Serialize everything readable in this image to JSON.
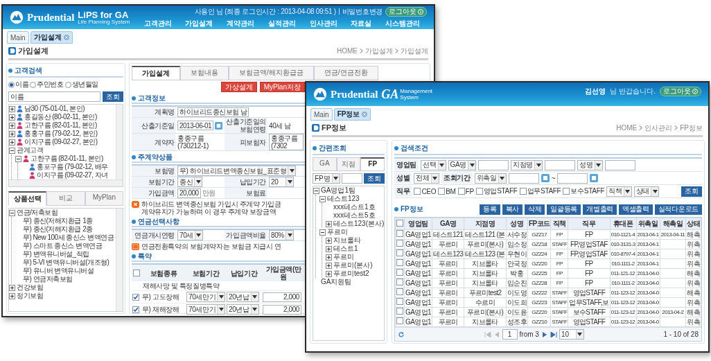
{
  "lips_window": {
    "brand": {
      "logo": "Prudential",
      "product": "LiPS for GA",
      "tagline": "Life Planning System"
    },
    "user_bar": {
      "greeting": "사용인 님 (최종 로그인시간 : 2013-04-08 09:51 )",
      "link": "비밀번호변경",
      "logout": "로그아웃"
    },
    "nav": [
      "고객관리",
      "가입설계",
      "계약관리",
      "실적관리",
      "인사관리",
      "자료실",
      "시스템관리"
    ],
    "open_tabs": [
      {
        "label": "Main",
        "selected": false,
        "closable": false
      },
      {
        "label": "가입설계",
        "selected": true,
        "closable": true
      }
    ],
    "page_title": "가입설계",
    "breadcrumb": [
      "HOME",
      "가입설계",
      "가입설계"
    ],
    "customer_search": {
      "title": "고객검색",
      "radios": [
        {
          "label": "이름",
          "selected": true
        },
        {
          "label": "주민번호",
          "selected": false
        },
        {
          "label": "생년월일",
          "selected": false
        }
      ],
      "query": "이름",
      "button": "조회",
      "tree": [
        {
          "label": "남30 (75-01-01, 본인)",
          "color": "#3a78c8",
          "expanded": false
        },
        {
          "label": "홍길동산 (80-02-11, 본인)",
          "color": "#3a78c8",
          "expanded": false
        },
        {
          "label": "고한구름 (82-01-11, 본인)",
          "color": "#c8396e",
          "expanded": false
        },
        {
          "label": "홍홍구름 (79-02-12, 본인)",
          "color": "#3a78c8",
          "expanded": false
        },
        {
          "label": "이지구름 (09-02-27, 본인)",
          "color": "#c8396e",
          "expanded": false
        },
        {
          "label": "관계고객",
          "expanded": true,
          "children": [
            {
              "label": "고한구름 (82-01-11, 본인)",
              "color": "#c8396e",
              "expanded": true,
              "children": [
                {
                  "label": "홍포구름 (79-02-12, 배우",
                  "color": "#3a78c8"
                },
                {
                  "label": "이지구름 (09-02-27, 자녀",
                  "color": "#c8396e"
                }
              ]
            }
          ]
        }
      ]
    },
    "product_tabs": [
      {
        "label": "상품선택",
        "selected": true
      },
      {
        "label": "비교",
        "selected": false
      },
      {
        "label": "MyPlan",
        "selected": false
      }
    ],
    "products": [
      {
        "label": "연금/저축보험",
        "expanded": true,
        "children": [
          {
            "label": "무) 종신(저해지환급 1종"
          },
          {
            "label": "무) 종신(저해지환급 2종"
          },
          {
            "label": "무) New 100세 종신스 변액연금"
          },
          {
            "label": "무) 스마트 종신스 변액연금"
          },
          {
            "label": "무) 변액유니버설_적립"
          },
          {
            "label": "무) 5-VI 변액유니버설(개조형)"
          },
          {
            "label": "무) 유니버 변액유니버설"
          },
          {
            "label": "무) 연금저축보험"
          }
        ]
      },
      {
        "label": "건강보험",
        "expanded": false
      },
      {
        "label": "정기보험",
        "expanded": false
      }
    ],
    "content_tabs": [
      {
        "label": "가입설계",
        "selected": true
      },
      {
        "label": "보험내용",
        "selected": false
      },
      {
        "label": "보험금액/해지환급금",
        "selected": false
      },
      {
        "label": "연금/연금전환",
        "selected": false
      }
    ],
    "action_buttons": [
      "가상설계",
      "MyPlan저장"
    ],
    "customer_info": {
      "title": "고객정보",
      "rows": [
        [
          {
            "label": "계획명",
            "kind": "input",
            "value": "하이브리드종신보험 남"
          }
        ],
        [
          {
            "label": "산출기준일",
            "kind": "date",
            "value": "2013-06-01"
          },
          {
            "label": "산출기준일의 보험연령",
            "kind": "text",
            "value": "40세 남"
          }
        ],
        [
          {
            "label": "계약자",
            "kind": "text",
            "value": "홍종구름(730212-1)"
          },
          {
            "label": "피보험자",
            "kind": "input",
            "value": "홍종구름(7302"
          }
        ]
      ]
    },
    "main_product": {
      "title": "주계약상품",
      "rows": [
        [
          {
            "label": "보험명",
            "kind": "select",
            "value": "무) 하이브리드변액종신보험_표준형"
          }
        ],
        [
          {
            "label": "보험기간",
            "kind": "select",
            "value": "종신"
          },
          {
            "label": "납입기간",
            "kind": "select",
            "value": "20"
          }
        ],
        [
          {
            "label": "가입금액",
            "kind": "input",
            "value": "20,000",
            "unit": "만원"
          },
          {
            "label": "보험료",
            "kind": "none"
          }
        ]
      ]
    },
    "notice": [
      "하이브리드 변액종신보험 가입시 주계약 가입금",
      "계약유지가 가능하며 이 경우 주계약 보장금액"
    ],
    "annuity": {
      "title": "연금선택사항",
      "rows": [
        [
          {
            "label": "연금개시연령",
            "kind": "select",
            "value": "70세"
          },
          {
            "label": "가입금액비율",
            "kind": "select",
            "value": "80%"
          }
        ]
      ]
    },
    "annuity_notice": [
      "연금전환특약의 보험계약자는 보험금 지급시 연"
    ],
    "riders": {
      "title": "특약",
      "all_checked": false,
      "columns": [
        "보험종류",
        "보험기간",
        "납입기간",
        "가입금액(만원"
      ],
      "group": "재해사망 및 특정질병특약",
      "rows": [
        {
          "checked": true,
          "name": "무) 고도장해",
          "term": "70세만기",
          "payment": "20년납",
          "amount": "2,000"
        },
        {
          "checked": true,
          "name": "무) 재해장해",
          "term": "70세만기",
          "payment": "20년납",
          "amount": "2,000"
        }
      ]
    }
  },
  "ga_window": {
    "brand": {
      "logo": "Prudential",
      "product": "GA",
      "product_sub": "Management System"
    },
    "user_bar": {
      "name": "김선영",
      "greeting": "님 반갑습니다.",
      "logout": "로그아웃"
    },
    "open_tabs": [
      {
        "label": "Main",
        "selected": false,
        "closable": false
      },
      {
        "label": "FP정보",
        "selected": true,
        "closable": true
      }
    ],
    "page_title": "FP정보",
    "breadcrumb": [
      "HOME",
      "인사관리",
      "FP정보"
    ],
    "quick_search": {
      "title": "간편조회",
      "tabs": [
        {
          "label": "GA",
          "selected": false
        },
        {
          "label": "지점",
          "selected": false
        },
        {
          "label": "FP",
          "selected": true
        }
      ],
      "field": "FP명",
      "button": "조회",
      "tree": [
        {
          "label": "GA영업1팀",
          "expanded": true,
          "children": [
            {
              "label": "테스트123",
              "expanded": true,
              "children": [
                {
                  "label": "xxx테스트1호"
                },
                {
                  "label": "xxx테스트5호"
                },
                {
                  "label": "테스트123(본사)",
                  "expanded": false
                }
              ]
            },
            {
              "label": "푸르미",
              "expanded": true,
              "children": [
                {
                  "label": "지브롤타",
                  "expanded": false
                },
                {
                  "label": "테스트1",
                  "expanded": false
                },
                {
                  "label": "푸르미",
                  "expanded": false
                },
                {
                  "label": "푸르미(본사)",
                  "expanded": false
                },
                {
                  "label": "푸르미test2",
                  "expanded": false
                }
              ]
            }
          ]
        },
        {
          "label": "GA지원팀"
        }
      ]
    },
    "filters": {
      "title": "검색조건",
      "rows": [
        [
          {
            "kind": "label",
            "text": "영업팀"
          },
          {
            "kind": "select",
            "value": "선택"
          },
          {
            "kind": "select",
            "value": "GA명"
          },
          {
            "kind": "input"
          },
          {
            "kind": "select",
            "value": "지점명"
          },
          {
            "kind": "input"
          },
          {
            "kind": "select",
            "value": "성명"
          },
          {
            "kind": "input"
          }
        ],
        [
          {
            "kind": "label",
            "text": "성별"
          },
          {
            "kind": "select",
            "value": "전체"
          },
          {
            "kind": "label",
            "text": "조회기간"
          },
          {
            "kind": "select",
            "value": "위촉일"
          },
          {
            "kind": "date"
          },
          {
            "kind": "text",
            "text": "~"
          },
          {
            "kind": "date"
          }
        ],
        [
          {
            "kind": "label",
            "text": "직무"
          },
          {
            "kind": "checkbox",
            "text": "CEO",
            "checked": false
          },
          {
            "kind": "checkbox",
            "text": "BM",
            "checked": false
          },
          {
            "kind": "checkbox",
            "text": "FP",
            "checked": false
          },
          {
            "kind": "checkbox",
            "text": "영업STAFF",
            "checked": false
          },
          {
            "kind": "checkbox",
            "text": "업무STAFF",
            "checked": false
          },
          {
            "kind": "checkbox",
            "text": "보수STAFF",
            "checked": false
          },
          {
            "kind": "select",
            "value": "직책"
          },
          {
            "kind": "select",
            "value": "상태"
          },
          {
            "kind": "button",
            "text": "조회"
          }
        ]
      ]
    },
    "grid": {
      "title": "FP정보",
      "buttons": [
        "등록",
        "복사",
        "삭제",
        "일괄등록",
        "개별출력",
        "엑셀출력",
        "실적다운로드"
      ],
      "all_checked": false,
      "columns": [
        "영업팀",
        "GA명",
        "지점명",
        "성명",
        "FP코드",
        "직책",
        "직무",
        "휴대폰",
        "위촉일",
        "해촉일",
        "상태"
      ],
      "rows": [
        {
          "checked": false,
          "cells": [
            "GA영업1",
            "테스트121",
            "테스트121 (본",
            "서수정",
            "GZZ17",
            "FP",
            "FP",
            "010-1121-4",
            "2013-04-1",
            "2013-04-11",
            "해촉"
          ]
        },
        {
          "checked": false,
          "cells": [
            "GA영업1",
            "푸르미",
            "푸르미(본사)",
            "임소정",
            "GZZ18",
            "STAFF",
            "FP,영업STAF",
            "010-3131-3",
            "2013-04-1",
            "",
            "위촉"
          ]
        },
        {
          "checked": false,
          "cells": [
            "GA영업1",
            "테스트123",
            "테스트123 (본",
            "우현이",
            "GZZ24",
            "FP",
            "FP,영업STAF",
            "010-8797-4",
            "2013-04-1",
            "",
            "위촉"
          ]
        },
        {
          "checked": false,
          "cells": [
            "GA영업1",
            "푸르미",
            "지브롤타",
            "안국정",
            "GZZ20",
            "FP",
            "FP",
            "010-1111-2",
            "2013-04-1",
            "",
            "위촉"
          ]
        },
        {
          "checked": false,
          "cells": [
            "GA영업1",
            "푸르미",
            "지브롤타",
            "박홍",
            "GZZ25",
            "FP",
            "FP",
            "011-121-12",
            "2013-04-0",
            "",
            "해촉"
          ]
        },
        {
          "checked": false,
          "cells": [
            "GA영업1",
            "푸르미",
            "지브롤타",
            "임순진",
            "GZZ28",
            "FP",
            "FP",
            "010-1111-2",
            "2013-04-0",
            "",
            "위촉"
          ]
        },
        {
          "checked": false,
          "cells": [
            "GA영업1",
            "푸르미",
            "푸르미test2",
            "이도영",
            "GZZ22",
            "STAFF",
            "영업STAFF",
            "011-123-12",
            "2013-04-0",
            "",
            "해촉"
          ]
        },
        {
          "checked": false,
          "cells": [
            "GA영업1",
            "푸르미",
            "수르미",
            "이도희",
            "GZZ23",
            "STAFF",
            "업무STAFF,보",
            "011-123-12",
            "2013-04-0",
            "",
            "위촉"
          ]
        },
        {
          "checked": false,
          "cells": [
            "GA영업1",
            "푸르미",
            "푸르미(본사)",
            "이도윤",
            "GZZ20",
            "STAFF",
            "보수STAFF",
            "011-123-12",
            "2013-04-0",
            "2013-04-2",
            "해촉"
          ]
        },
        {
          "checked": false,
          "cells": [
            "GA영업1",
            "푸르미",
            "지브롤타",
            "성조후",
            "GZZ10",
            "STAFF",
            "영업STAFF",
            "011-123-12",
            "2013-04-0",
            "",
            "위촉"
          ]
        }
      ]
    },
    "pager": {
      "page": "1",
      "of": "from 3",
      "page_size": "10",
      "summary": "1 - 10 of 28"
    }
  }
}
